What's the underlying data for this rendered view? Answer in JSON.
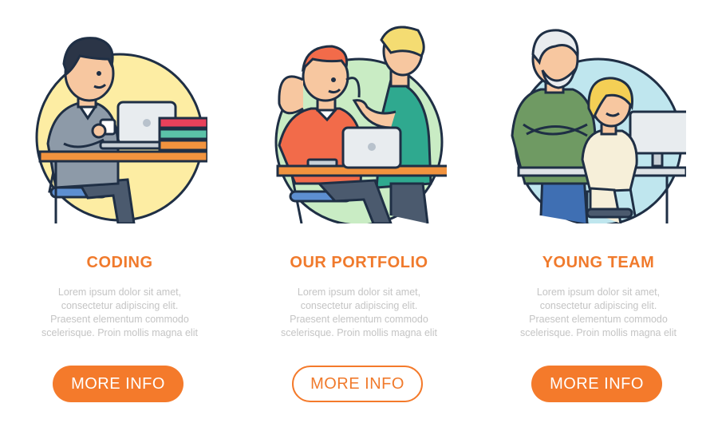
{
  "cards": [
    {
      "title": "CODING",
      "desc_lines": [
        "Lorem ipsum dolor sit amet,",
        "consectetur adipiscing elit.",
        "Praesent elementum commodo",
        "scelerisque. Proin mollis magna elit"
      ],
      "button_label": "MORE INFO",
      "button_style": "filled",
      "circle_color": "#fdeda3"
    },
    {
      "title": "OUR PORTFOLIO",
      "desc_lines": [
        "Lorem ipsum dolor sit amet,",
        "consectetur adipiscing elit.",
        "Praesent elementum commodo",
        "scelerisque. Proin mollis magna elit"
      ],
      "button_label": "MORE INFO",
      "button_style": "outline",
      "circle_color": "#c9ecc4"
    },
    {
      "title": "YOUNG TEAM",
      "desc_lines": [
        "Lorem ipsum dolor sit amet,",
        "consectetur adipiscing elit.",
        "Praesent elementum commodo",
        "scelerisque. Proin mollis magna elit"
      ],
      "button_label": "MORE INFO",
      "button_style": "filled",
      "circle_color": "#bfe6ee"
    }
  ],
  "colors": {
    "accent": "#f47a2b",
    "text_muted": "#c4c4c4",
    "outline": "#1f2f45"
  }
}
